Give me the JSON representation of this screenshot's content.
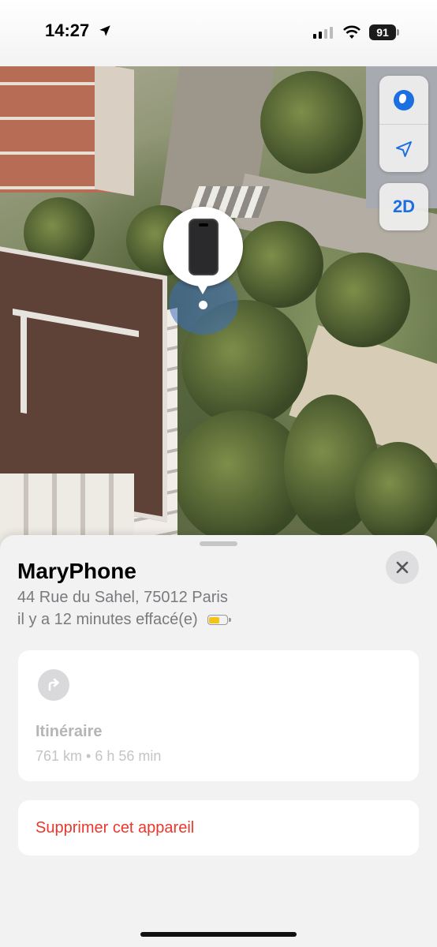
{
  "status_bar": {
    "time": "14:27",
    "battery_percent": "91"
  },
  "map": {
    "controls": {
      "globe_icon": "globe-icon",
      "location_icon": "location-arrow-icon",
      "view_mode_label": "2D"
    },
    "device_pin_icon": "iphone-icon",
    "colors": {
      "accent": "#1c6fe0",
      "halo": "#3c6ebe"
    }
  },
  "sheet": {
    "device_name": "MaryPhone",
    "address": "44 Rue du Sahel, 75012 Paris",
    "last_seen": "il y a 12 minutes effacé(e)",
    "battery_level": 0.6,
    "battery_color": "#f0c419",
    "close_icon": "close-icon",
    "directions": {
      "icon": "turn-right-arrow-icon",
      "title": "Itinéraire",
      "subtitle": "761 km • 6 h 56 min"
    },
    "remove_label": "Supprimer cet appareil",
    "remove_color": "#e8382d"
  }
}
